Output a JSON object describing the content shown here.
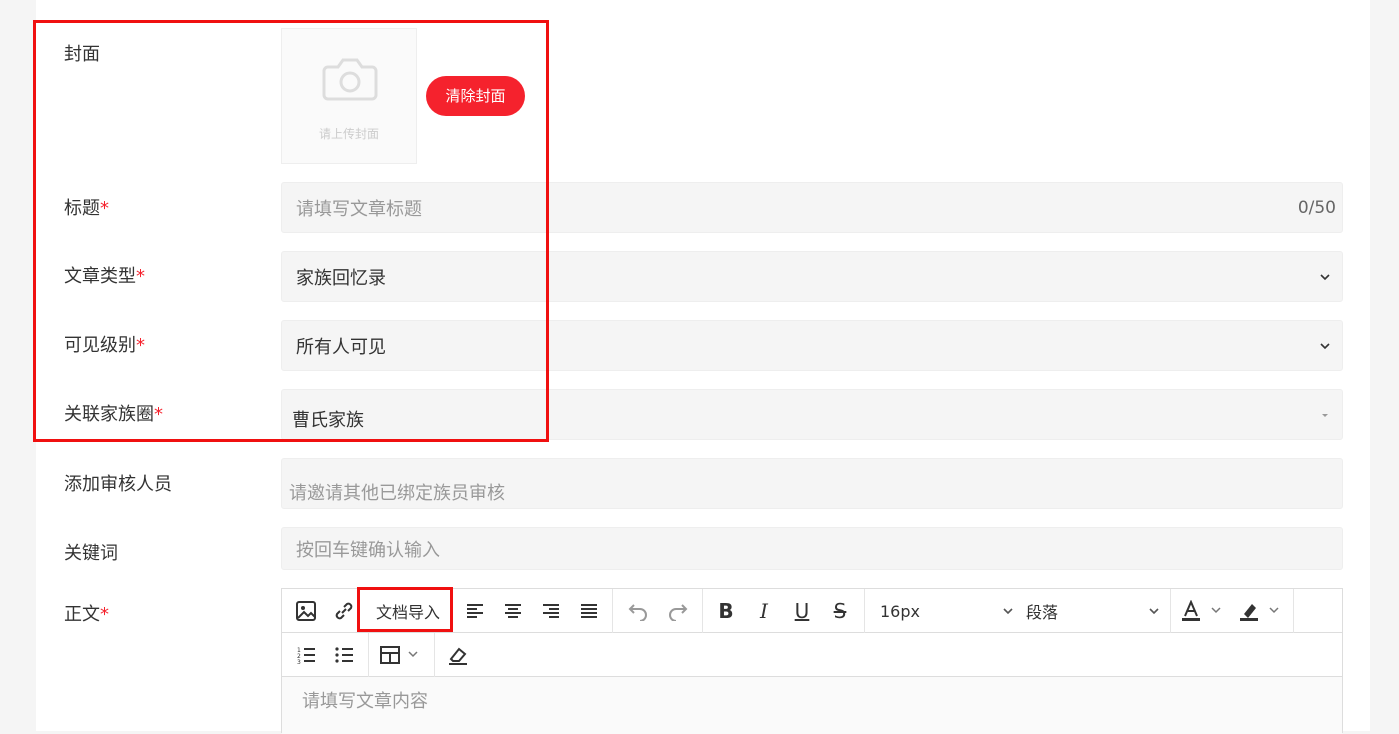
{
  "cover": {
    "label": "封面",
    "upload_hint": "请上传封面",
    "clear_button": "清除封面"
  },
  "title": {
    "label": "标题",
    "required_mark": "*",
    "placeholder": "请填写文章标题",
    "counter": "0/50"
  },
  "article_type": {
    "label": "文章类型",
    "required_mark": "*",
    "value": "家族回忆录"
  },
  "visibility": {
    "label": "可见级别",
    "required_mark": "*",
    "value": "所有人可见"
  },
  "family_circle": {
    "label": "关联家族圈",
    "required_mark": "*",
    "value": "曹氏家族"
  },
  "reviewers": {
    "label": "添加审核人员",
    "placeholder": "请邀请其他已绑定族员审核"
  },
  "keywords": {
    "label": "关键词",
    "placeholder": "按回车键确认输入"
  },
  "body": {
    "label": "正文",
    "required_mark": "*",
    "placeholder": "请填写文章内容",
    "toolbar": {
      "doc_import": "文档导入",
      "font_size": "16px",
      "paragraph": "段落",
      "bold": "B",
      "italic": "I",
      "underline": "U",
      "strike": "S"
    }
  },
  "colors": {
    "accent": "#f5222d",
    "highlight_box": "#f01010"
  }
}
